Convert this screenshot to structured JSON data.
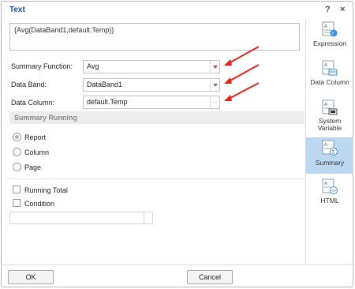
{
  "window": {
    "title": "Text",
    "help_label": "?",
    "close_label": "×"
  },
  "expression": {
    "value": "{Avg(DataBand1,default.Temp)}"
  },
  "form": {
    "summary_function": {
      "label": "Summary Function:",
      "value": "Avg"
    },
    "data_band": {
      "label": "Data Band:",
      "value": "DataBand1"
    },
    "data_column": {
      "label": "Data Column:",
      "value": "default.Temp",
      "browse_label": "..."
    }
  },
  "summary_running": {
    "title": "Summary Running",
    "options": [
      "Report",
      "Column",
      "Page"
    ],
    "selected": "Report"
  },
  "checkboxes": {
    "running_total": {
      "label": "Running Total",
      "checked": false
    },
    "condition": {
      "label": "Condition",
      "checked": false
    }
  },
  "sidebar": {
    "items": [
      {
        "label": "Expression",
        "icon": "expression-icon",
        "selected": false
      },
      {
        "label": "Data Column",
        "icon": "data-column-icon",
        "selected": false
      },
      {
        "label": "System Variable",
        "icon": "system-variable-icon",
        "selected": false
      },
      {
        "label": "Summary",
        "icon": "summary-icon",
        "selected": true
      },
      {
        "label": "HTML",
        "icon": "html-icon",
        "selected": false
      }
    ]
  },
  "footer": {
    "ok_label": "OK",
    "cancel_label": "Cancel"
  },
  "colors": {
    "title": "#1b4f9c",
    "selected_item": "#bcd7f0",
    "annotation_arrow": "#e3241b"
  }
}
